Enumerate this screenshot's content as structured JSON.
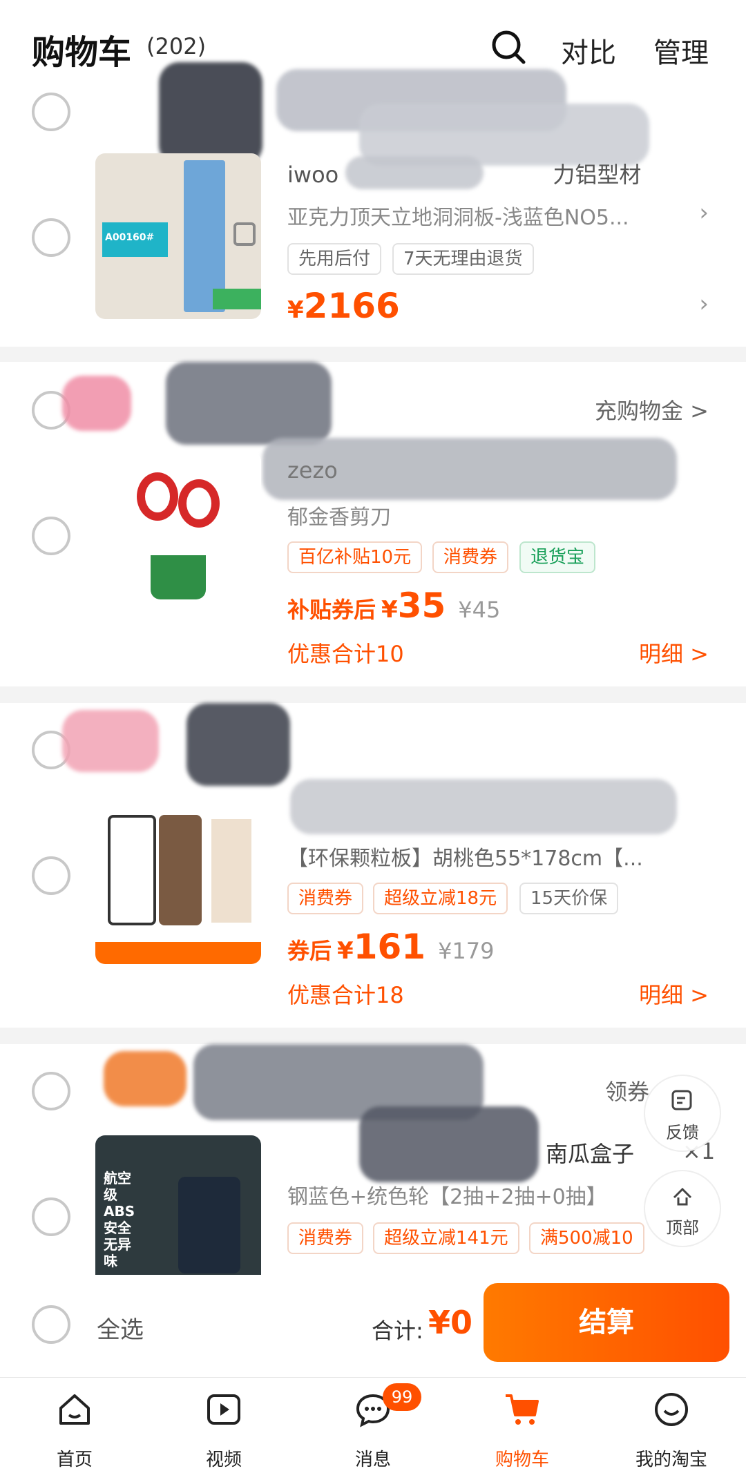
{
  "header": {
    "title": "购物车",
    "count": "(202)",
    "compare": "对比",
    "manage": "管理"
  },
  "items": [
    {
      "title_fragment": "iwoo",
      "title_tail": "力铝型材",
      "variant": "亚克力顶天立地洞洞板-浅蓝色NO5...",
      "tags": [
        "先用后付",
        "7天无理由退货"
      ],
      "price_yen": "¥",
      "price": "2166",
      "thumb_text": "A00160#"
    },
    {
      "shop_link": "充购物金 >",
      "title_fragment": "zezo",
      "variant": "郁金香剪刀",
      "tags": [
        "百亿补贴10元",
        "消费券",
        "退货宝"
      ],
      "price_prefix": "补贴券后",
      "price_yen": "¥",
      "price": "35",
      "orig_price": "¥45",
      "discount": "优惠合计10",
      "detail": "明细 >"
    },
    {
      "variant": "【环保颗粒板】胡桃色55*178cm【...",
      "tags": [
        "消费券",
        "超级立减18元",
        "15天价保"
      ],
      "price_prefix": "券后",
      "price_yen": "¥",
      "price": "161",
      "orig_price": "¥179",
      "discount": "优惠合计18",
      "detail": "明细 >"
    },
    {
      "shop_link": "领券",
      "title_fragment": "南瓜盒子",
      "qty": "×1",
      "variant": "钢蓝色+统色轮【2抽+2抽+0抽】",
      "tags": [
        "消费券",
        "超级立减141元",
        "满500减10"
      ],
      "thumb_text": "航空级ABS安全无异味"
    }
  ],
  "floating": {
    "feedback": "反馈",
    "top": "顶部"
  },
  "checkout": {
    "select_all": "全选",
    "total_label": "合计:",
    "total_value": "¥0",
    "pay_button": "结算"
  },
  "tabbar": [
    {
      "label": "首页",
      "icon": "home-icon"
    },
    {
      "label": "视频",
      "icon": "video-icon"
    },
    {
      "label": "消息",
      "icon": "message-icon",
      "badge": "99"
    },
    {
      "label": "购物车",
      "icon": "cart-icon",
      "active": true
    },
    {
      "label": "我的淘宝",
      "icon": "profile-icon"
    }
  ],
  "colors": {
    "accent": "#ff5000",
    "background": "#f3f3f3"
  }
}
